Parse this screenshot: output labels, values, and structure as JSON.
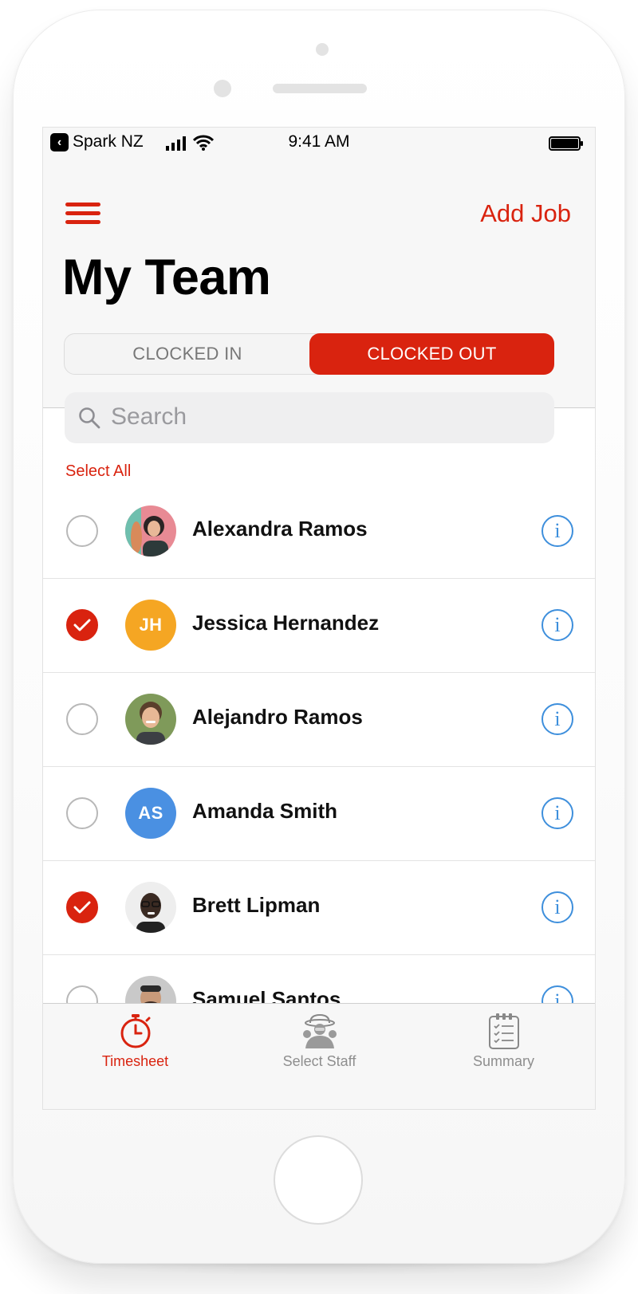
{
  "status_bar": {
    "carrier": "Spark NZ",
    "time": "9:41 AM"
  },
  "header": {
    "add_job_label": "Add Job",
    "title": "My Team",
    "segments": [
      {
        "label": "CLOCKED IN",
        "selected": false
      },
      {
        "label": "CLOCKED OUT",
        "selected": true
      }
    ]
  },
  "search": {
    "placeholder": "Search"
  },
  "select_all_label": "Select All",
  "staff": [
    {
      "name": "Alexandra Ramos",
      "checked": false,
      "avatar": "photo-woman"
    },
    {
      "name": "Jessica Hernandez",
      "checked": true,
      "avatar": "initials",
      "initials": "JH",
      "color": "#f5a623"
    },
    {
      "name": "Alejandro Ramos",
      "checked": false,
      "avatar": "photo-man"
    },
    {
      "name": "Amanda Smith",
      "checked": false,
      "avatar": "initials",
      "initials": "AS",
      "color": "#4a90e2"
    },
    {
      "name": "Brett Lipman",
      "checked": true,
      "avatar": "photo-man-dark"
    },
    {
      "name": "Samuel Santos",
      "checked": false,
      "avatar": "photo-man-beard"
    }
  ],
  "tabbar": {
    "tabs": [
      {
        "label": "Timesheet",
        "icon": "stopwatch-icon",
        "active": true
      },
      {
        "label": "Select Staff",
        "icon": "workers-icon",
        "active": false
      },
      {
        "label": "Summary",
        "icon": "clipboard-icon",
        "active": false
      }
    ]
  },
  "colors": {
    "accent": "#d9230f",
    "info": "#3e8fdc"
  }
}
